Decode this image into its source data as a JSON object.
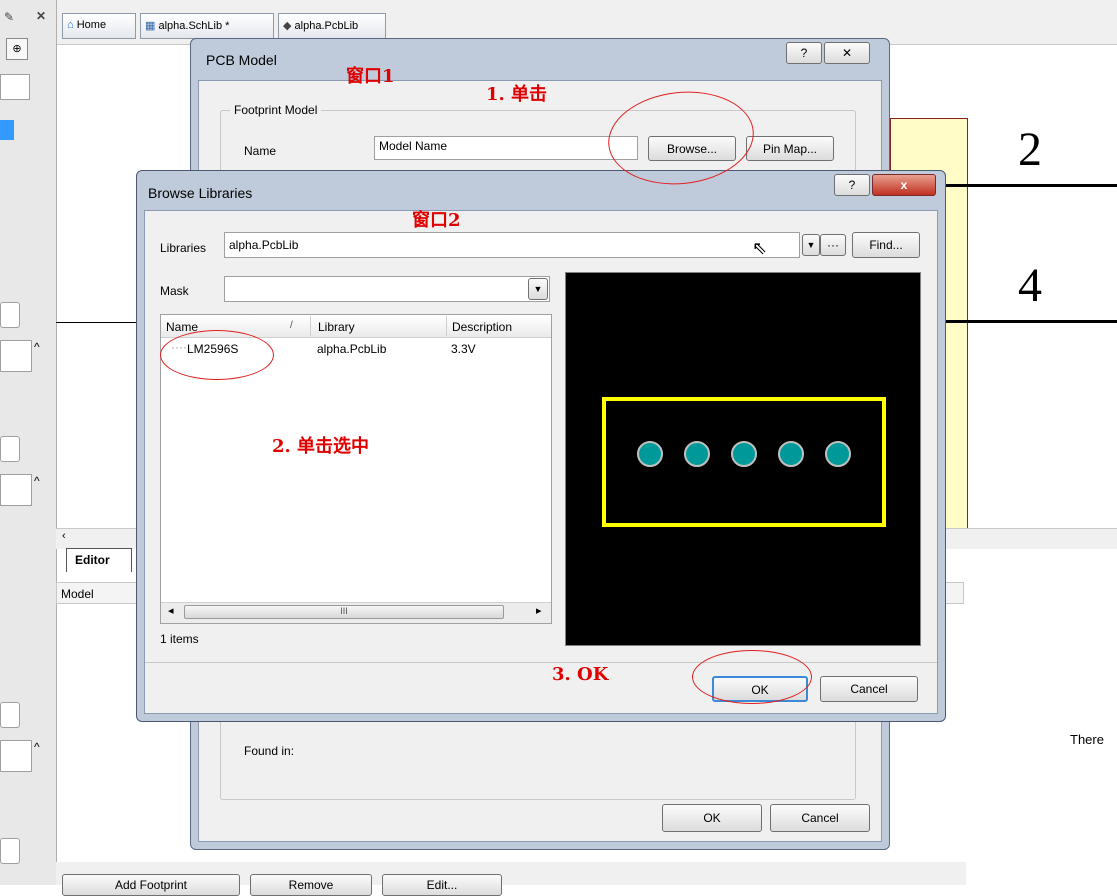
{
  "tabs": [
    {
      "label": "Home"
    },
    {
      "label": "alpha.SchLib *"
    },
    {
      "label": "alpha.PcbLib"
    }
  ],
  "editor": {
    "tab_label": "Editor",
    "model_column": "Model",
    "truncated_text": "There",
    "bottom_buttons": [
      "Add Footprint",
      "Remove",
      "Edit..."
    ]
  },
  "schematic": {
    "pin_numbers": [
      "2",
      "4"
    ],
    "body_color": "#fffcc8"
  },
  "pcb_model_dialog": {
    "title": "PCB Model",
    "help": "?",
    "close": "✕",
    "group_label": "Footprint Model",
    "name_label": "Name",
    "name_value": "Model Name",
    "browse_button": "Browse...",
    "pinmap_button": "Pin Map...",
    "found_in_label": "Found in:",
    "ok_button": "OK",
    "cancel_button": "Cancel"
  },
  "browse_libraries_dialog": {
    "title": "Browse Libraries",
    "help": "?",
    "close": "x",
    "libraries_label": "Libraries",
    "libraries_value": "alpha.PcbLib",
    "more_button": "···",
    "find_button": "Find...",
    "mask_label": "Mask",
    "mask_value": "",
    "columns": [
      "Name",
      "Library",
      "Description"
    ],
    "rows": [
      {
        "name": "LM2596S",
        "library": "alpha.PcbLib",
        "description": "3.3V"
      }
    ],
    "scrollbar_thumb_marks": "III",
    "items_count": "1 items",
    "ok_button": "OK",
    "cancel_button": "Cancel",
    "preview": {
      "background": "#000000",
      "outline_color": "#ffff00",
      "pad_color": "#009999",
      "pad_count": 5
    }
  },
  "annotations": {
    "window1": "窗口1",
    "step1": "1. 单击",
    "window2": "窗口2",
    "step2": "2. 单击选中",
    "step3": "3. OK"
  }
}
